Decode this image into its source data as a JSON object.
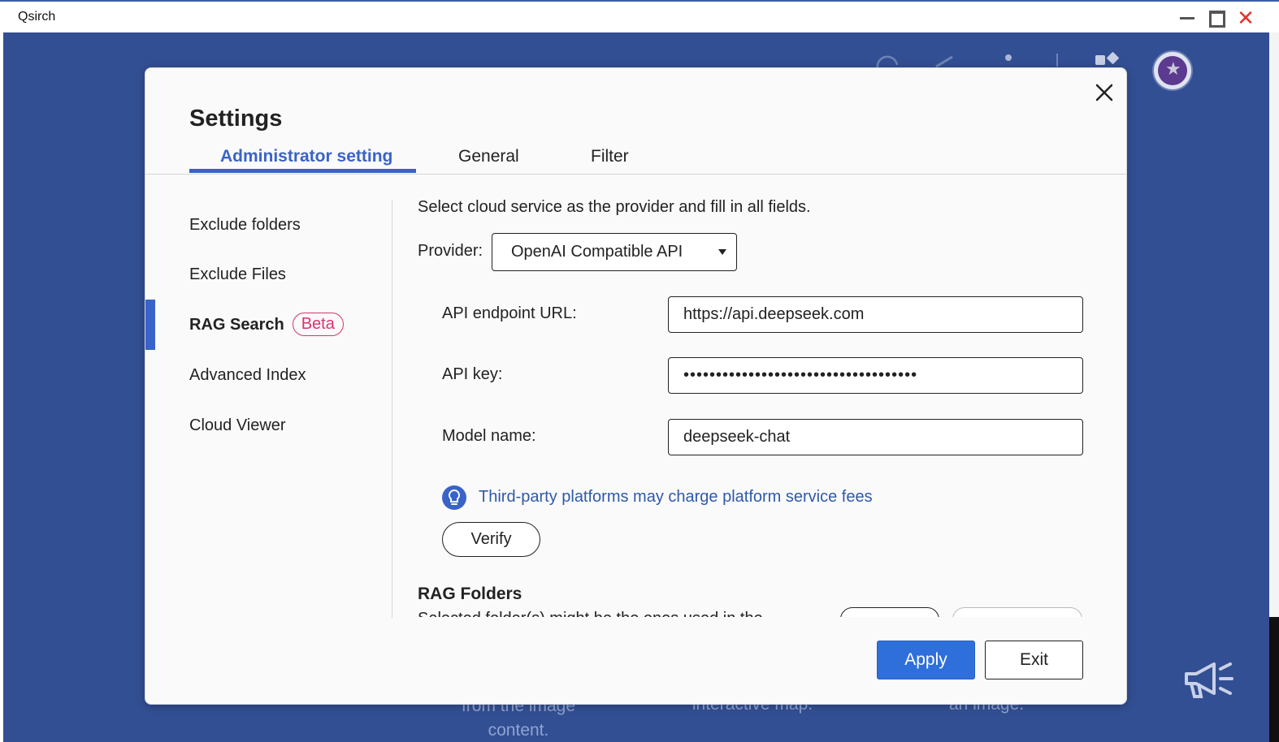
{
  "window": {
    "title": "Qsirch"
  },
  "background": {
    "snippets": [
      "from the image",
      "content.",
      "interactive map.",
      "an image."
    ]
  },
  "dialog": {
    "title": "Settings",
    "tabs": [
      {
        "label": "Administrator setting",
        "active": true
      },
      {
        "label": "General",
        "active": false
      },
      {
        "label": "Filter",
        "active": false
      }
    ],
    "sidebar": {
      "items": [
        {
          "label": "Exclude folders"
        },
        {
          "label": "Exclude Files"
        },
        {
          "label": "RAG Search",
          "badge": "Beta",
          "active": true
        },
        {
          "label": "Advanced Index"
        },
        {
          "label": "Cloud Viewer"
        }
      ]
    },
    "content": {
      "intro": "Select cloud service as the provider and fill in all fields.",
      "provider": {
        "label": "Provider:",
        "value": "OpenAI Compatible API"
      },
      "fields": {
        "endpoint_label": "API endpoint URL:",
        "endpoint_value": "https://api.deepseek.com",
        "key_label": "API key:",
        "key_value": "••••••••••••••••••••••••••••••••••••",
        "model_label": "Model name:",
        "model_value": "deepseek-chat"
      },
      "hint": "Third-party platforms may charge platform service fees",
      "verify_label": "Verify",
      "rag_folders_title": "RAG Folders",
      "rag_folders_desc": "Selected folder(s) might be the ones used in the"
    },
    "footer": {
      "apply_label": "Apply",
      "exit_label": "Exit"
    }
  },
  "colors": {
    "accent": "#3a63c7",
    "apply_button": "#2f6fdc",
    "beta_badge": "#d9346f",
    "backdrop": "#334f93",
    "hint_text": "#2f5aa8",
    "close_window": "#e0352b"
  }
}
